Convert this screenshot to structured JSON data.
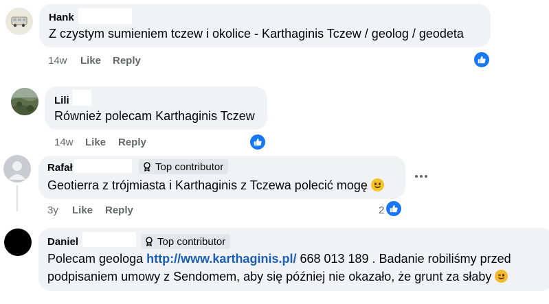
{
  "comments": [
    {
      "author": "Hank",
      "text": "Z czystym sumieniem tczew i okolice - Karthaginis Tczew / geolog / geodeta",
      "time": "14w",
      "like_label": "Like",
      "reply_label": "Reply",
      "avatar_icon": "van-avatar-icon",
      "reaction": "like-reaction-icon"
    },
    {
      "author": "Lili",
      "text": "Również polecam Karthaginis Tczew",
      "time": "14w",
      "like_label": "Like",
      "reply_label": "Reply",
      "avatar_icon": "landscape-avatar-icon",
      "reaction": "like-reaction-icon"
    },
    {
      "author": "Rafał",
      "badge": "Top contributor",
      "text": "Geotierra z trójmiasta i Karthaginis z Tczewa polecić mogę",
      "time": "3y",
      "like_label": "Like",
      "reply_label": "Reply",
      "reaction_count": "2",
      "avatar_icon": "default-person-avatar-icon",
      "reaction": "like-reaction-icon"
    },
    {
      "author": "Daniel",
      "badge": "Top contributor",
      "text_before": "Polecam geologa ",
      "link": "http://www.karthaginis.pl/",
      "text_after": " 668 013 189 . Badanie robiliśmy przed",
      "text_line2": "podpisaniem umowy z Sendomem, aby się później nie okazało, że grunt za słaby",
      "avatar_icon": "black-avatar-icon"
    }
  ],
  "colors": {
    "bubble": "#f0f2f5",
    "like_blue": "#1877f2",
    "meta_gray": "#65676b",
    "link": "#1a5fb4"
  }
}
